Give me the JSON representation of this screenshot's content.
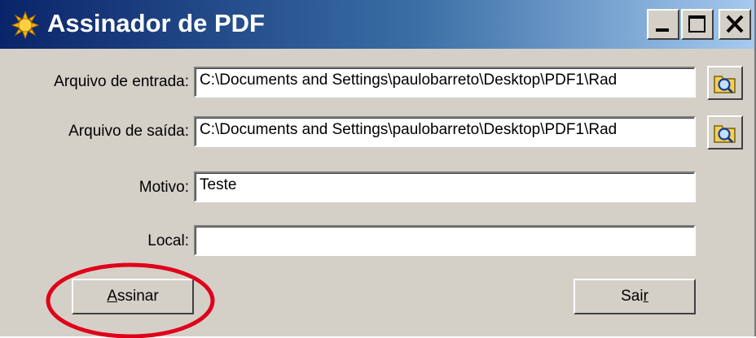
{
  "window": {
    "title": "Assinador de PDF",
    "controls": {
      "minimize": "minimize-icon",
      "maximize": "maximize-icon",
      "close": "close-icon"
    }
  },
  "form": {
    "input_label": "Arquivo de entrada:",
    "input_value": "C:\\Documents and Settings\\paulobarreto\\Desktop\\PDF1\\Rad",
    "output_label": "Arquivo de saída:",
    "output_value": "C:\\Documents and Settings\\paulobarreto\\Desktop\\PDF1\\Rad",
    "reason_label": "Motivo:",
    "reason_value": "Teste",
    "location_label": "Local:",
    "location_value": ""
  },
  "buttons": {
    "sign_label": "Assinar",
    "sign_mnemonic": "A",
    "sign_rest": "ssinar",
    "exit_label": "Sair",
    "exit_prefix": "Sai",
    "exit_mnemonic": "r"
  },
  "colors": {
    "title_gradient_start": "#0a246a",
    "title_gradient_end": "#a6caf0",
    "face": "#d4d0c8",
    "annotation_circle": "#e0001a"
  },
  "icons": {
    "app": "sun-icon",
    "browse": "folder-search-icon"
  }
}
